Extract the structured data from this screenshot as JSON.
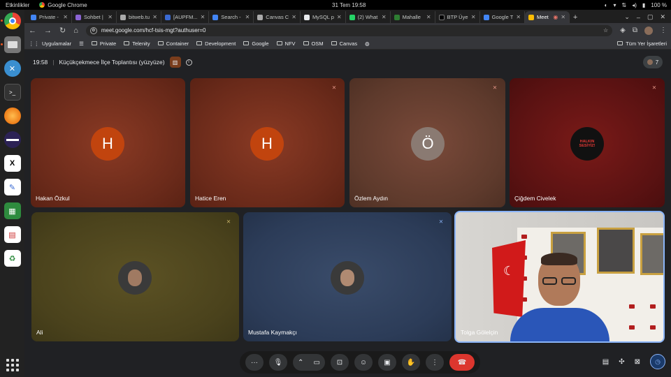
{
  "system": {
    "activities": "Etkinlikler",
    "app_name": "Google Chrome",
    "datetime": "31 Tem  19:58",
    "battery": "100 %"
  },
  "tabs": [
    {
      "title": "Private - ",
      "color": "#4285f4"
    },
    {
      "title": "Sohbet |",
      "color": "#8a63d2"
    },
    {
      "title": "bitweb.tu",
      "color": "#aaaaaa"
    },
    {
      "title": "[AUPFM...",
      "color": "#3a6ad2"
    },
    {
      "title": "Search - ",
      "color": "#4285f4"
    },
    {
      "title": "Canvas C",
      "color": "#aaaaaa"
    },
    {
      "title": "MySQL p",
      "color": "#e8eaed"
    },
    {
      "title": "(2) What",
      "color": "#25d366"
    },
    {
      "title": "Mahalle ",
      "color": "#2e7d32"
    },
    {
      "title": "BTP Üye",
      "color": "#000000"
    },
    {
      "title": "Google T",
      "color": "#4285f4"
    },
    {
      "title": "Meet",
      "color": "#fbbc04"
    }
  ],
  "address": {
    "url": "meet.google.com/hcf-tsis-mgt?authuser=0"
  },
  "bookmarks": {
    "apps": "Uygulamalar",
    "items": [
      "Private",
      "Telenity",
      "Container",
      "Development",
      "Google",
      "NFV",
      "OSM",
      "Canvas"
    ],
    "all": "Tüm Yer İşaretleri"
  },
  "meeting": {
    "time": "19:58",
    "title": "Küçükçekmece İlçe Toplantısı (yüzyüze)",
    "participant_count": "7"
  },
  "participants": [
    {
      "name": "Hakan Özkul",
      "initial": "H",
      "avatar_color": "#c1440e",
      "muted": false
    },
    {
      "name": "Hatice Eren",
      "initial": "H",
      "avatar_color": "#c1440e",
      "muted": true
    },
    {
      "name": "Özlem Aydın",
      "initial": "Ö",
      "avatar_color": "#8a7a72",
      "muted": true
    },
    {
      "name": "Çiğdem Civelek",
      "initial": "",
      "avatar_color": "#1a1a1a",
      "muted": true
    },
    {
      "name": "Ali",
      "initial": "",
      "avatar_color": "#3a3a3a",
      "muted": true
    },
    {
      "name": "Mustafa Kaymakçı",
      "initial": "",
      "avatar_color": "#3a3a3a",
      "muted": true
    },
    {
      "name": "Tolga Gölelçin",
      "initial": "",
      "avatar_color": "",
      "muted": false
    }
  ],
  "badge_text": "HALKIN SESİYİZ!"
}
